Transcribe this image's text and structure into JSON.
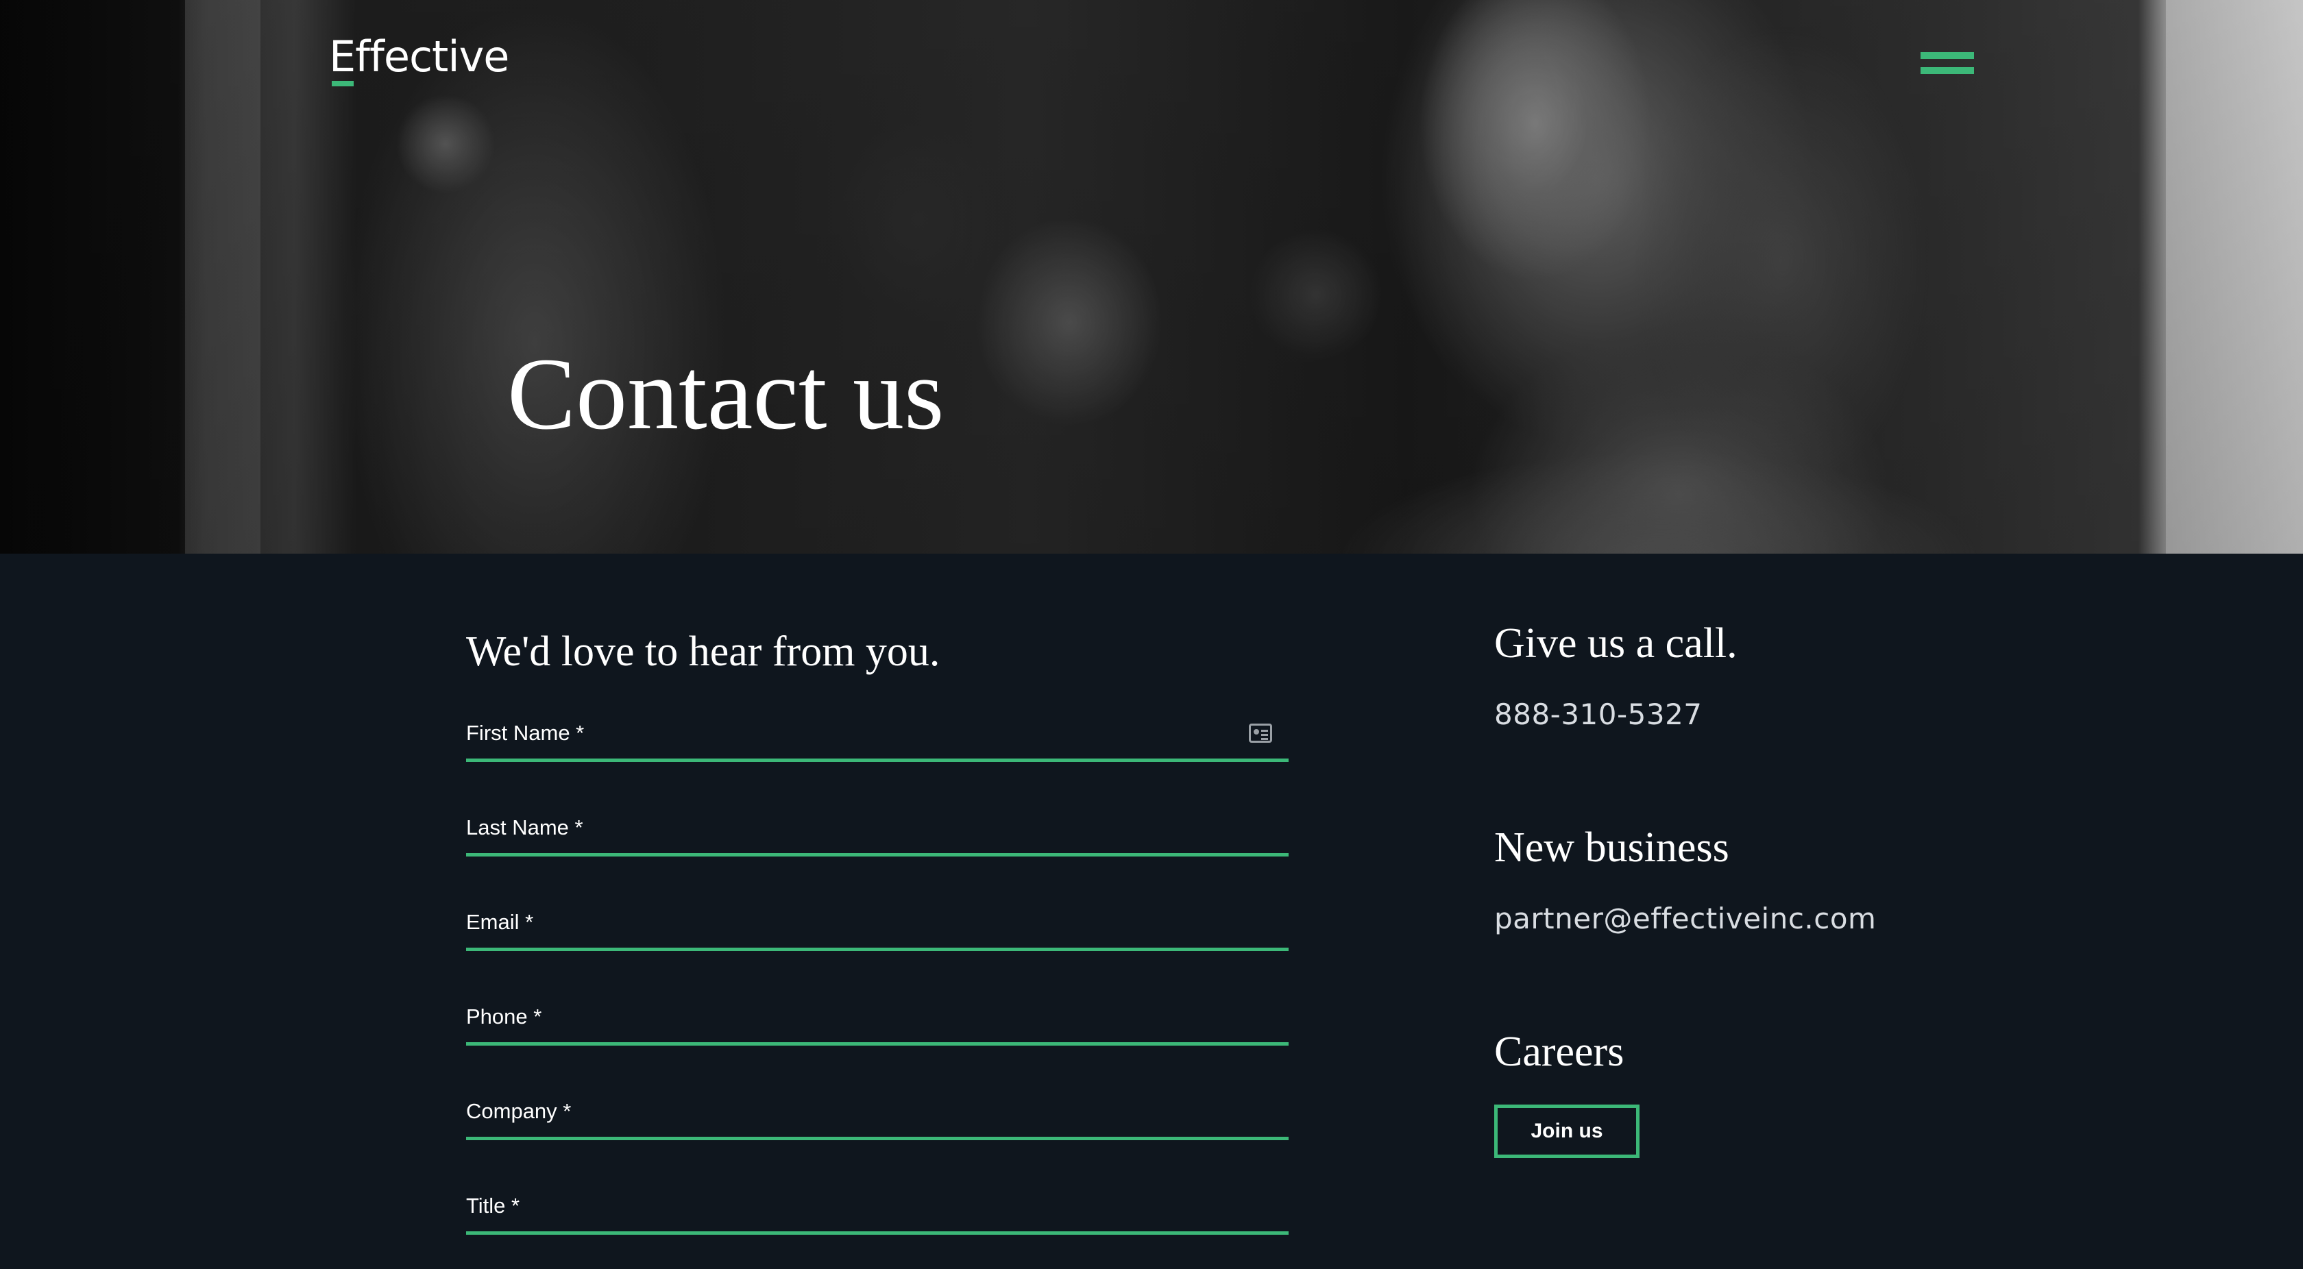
{
  "header": {
    "logo_text": "Effective",
    "menu_icon": "hamburger-menu-icon",
    "accent_color": "#3cb878"
  },
  "hero": {
    "title": "Contact us"
  },
  "form": {
    "heading": "We'd love to hear from you.",
    "fields": [
      {
        "label": "First Name *",
        "value": ""
      },
      {
        "label": "Last Name *",
        "value": ""
      },
      {
        "label": "Email *",
        "value": ""
      },
      {
        "label": "Phone *",
        "value": ""
      },
      {
        "label": "Company *",
        "value": ""
      },
      {
        "label": "Title *",
        "value": ""
      }
    ],
    "autofill_icon": "contact-card-icon"
  },
  "contact": {
    "call": {
      "heading": "Give us a call.",
      "phone": "888-310-5327"
    },
    "new_business": {
      "heading": "New business",
      "email": "partner@effectiveinc.com"
    },
    "careers": {
      "heading": "Careers",
      "button_label": "Join us"
    }
  },
  "colors": {
    "background": "#0f161e",
    "accent": "#3cb878",
    "text": "#ffffff"
  }
}
